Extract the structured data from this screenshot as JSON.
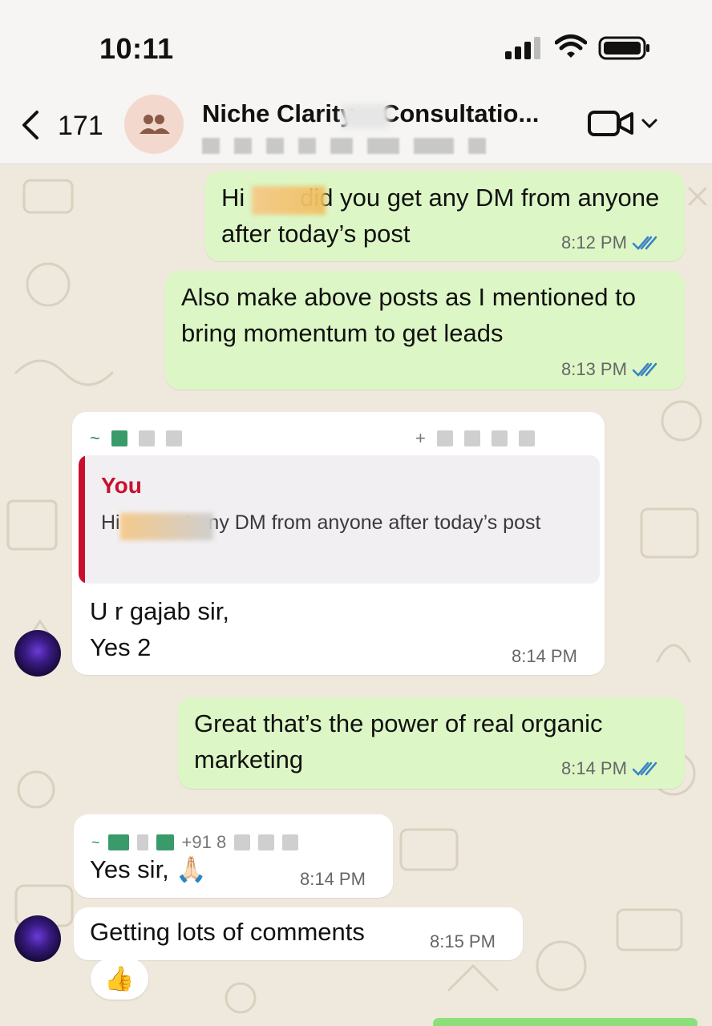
{
  "status": {
    "time": "10:11"
  },
  "header": {
    "back_count": "171",
    "title": "Niche Clarity – Consultatio..."
  },
  "messages": [
    {
      "text": "Hi        did you get any DM from anyone after today’s post",
      "time": "8:12 PM"
    },
    {
      "text": "Also make above posts as I mentioned to bring momentum to get leads",
      "time": "8:13 PM"
    },
    {
      "quote_sender": "You",
      "quote_text": "Hi        you get any DM from anyone after today’s post",
      "text": "U r gajab sir,\nYes 2",
      "time": "8:14 PM"
    },
    {
      "text": "Great that’s the power of real organic marketing",
      "time": "8:14 PM"
    },
    {
      "sender_fragment": "+91 8",
      "text": "Yes sir, 🙏🏻",
      "time": "8:14 PM"
    },
    {
      "text": "Getting lots of comments",
      "time": "8:15 PM"
    }
  ],
  "reaction": "👍",
  "colors": {
    "outgoing": "#dcf7c5",
    "incoming": "#ffffff",
    "read_ticks": "#3b82c4",
    "quote_accent": "#c8102e"
  },
  "icons": [
    "back-chevron-icon",
    "group-icon",
    "video-call-icon",
    "chevron-down-icon",
    "signal-icon",
    "wifi-icon",
    "battery-icon",
    "double-check-icon"
  ]
}
